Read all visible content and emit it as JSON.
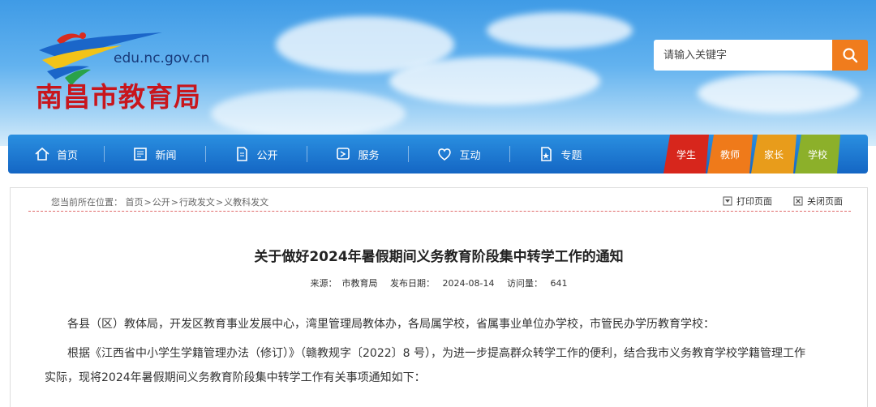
{
  "header": {
    "domain": "edu.nc.gov.cn",
    "site_title": "南昌市教育局",
    "search_placeholder": "请输入关键字",
    "search_icon": "search-icon"
  },
  "nav": {
    "items": [
      {
        "label": "首页",
        "icon": "home-icon"
      },
      {
        "label": "新闻",
        "icon": "news-icon"
      },
      {
        "label": "公开",
        "icon": "document-icon"
      },
      {
        "label": "服务",
        "icon": "service-icon"
      },
      {
        "label": "互动",
        "icon": "heart-icon"
      },
      {
        "label": "专题",
        "icon": "topic-icon"
      }
    ],
    "tabs": [
      {
        "label": "学生",
        "color": "#d7261c"
      },
      {
        "label": "教师",
        "color": "#ef7a1a"
      },
      {
        "label": "家长",
        "color": "#e89c1b"
      },
      {
        "label": "学校",
        "color": "#8cb02a"
      }
    ]
  },
  "breadcrumb": {
    "prefix": "您当前所在位置：",
    "items": [
      "首页",
      "公开",
      "行政发文",
      "义教科发文"
    ],
    "sep": ">"
  },
  "tools": {
    "print": "打印页面",
    "close": "关闭页面"
  },
  "article": {
    "title": "关于做好2024年暑假期间义务教育阶段集中转学工作的通知",
    "source_label": "来源：",
    "source": "市教育局",
    "date_label": "发布日期：",
    "date": "2024-08-14",
    "views_label": "访问量：",
    "views": "641",
    "para1": "各县（区）教体局，开发区教育事业发展中心，湾里管理局教体办，各局属学校，省属事业单位办学校，市管民办学历教育学校：",
    "para2_line1": "根据《江西省中小学生学籍管理办法（修订）》（赣教规字〔2022〕8 号），为进一步提高群众转学工作的便利，结合我市义务教育学校学籍管理工作",
    "para2_line2": "实际，现将2024年暑假期间义务教育阶段集中转学工作有关事项通知如下："
  }
}
